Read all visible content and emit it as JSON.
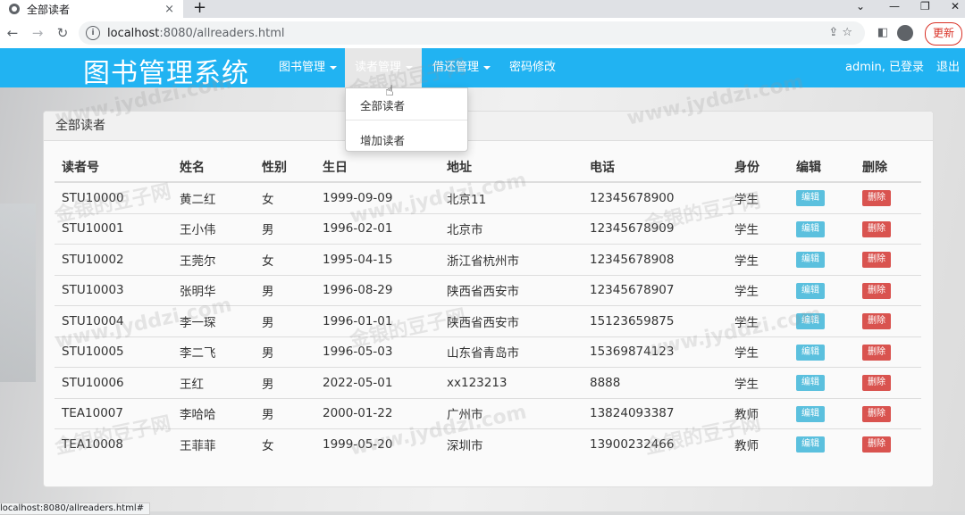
{
  "browser": {
    "tab_title": "全部读者",
    "tab_close": "×",
    "new_tab": "+",
    "url_host": "localhost",
    "url_path": ":8080/allreaders.html",
    "update_label": "更新",
    "status_url": "localhost:8080/allreaders.html#"
  },
  "nav": {
    "brand": "图书管理系统",
    "menus": [
      {
        "label": "图书管理"
      },
      {
        "label": "读者管理"
      },
      {
        "label": "借还管理"
      },
      {
        "label": "密码修改"
      }
    ],
    "user": "admin, 已登录",
    "logout": "退出"
  },
  "dropdown": {
    "items": [
      {
        "label": "全部读者"
      },
      {
        "label": "增加读者"
      }
    ]
  },
  "panel": {
    "title": "全部读者",
    "columns": [
      "读者号",
      "姓名",
      "性别",
      "生日",
      "地址",
      "电话",
      "身份",
      "编辑",
      "删除"
    ],
    "edit_label": "编辑",
    "delete_label": "删除",
    "rows": [
      {
        "id": "STU10000",
        "name": "黄二红",
        "sex": "女",
        "birth": "1999-09-09",
        "addr": "北京11",
        "phone": "12345678900",
        "role": "学生"
      },
      {
        "id": "STU10001",
        "name": "王小伟",
        "sex": "男",
        "birth": "1996-02-01",
        "addr": "北京市",
        "phone": "12345678909",
        "role": "学生"
      },
      {
        "id": "STU10002",
        "name": "王莞尔",
        "sex": "女",
        "birth": "1995-04-15",
        "addr": "浙江省杭州市",
        "phone": "12345678908",
        "role": "学生"
      },
      {
        "id": "STU10003",
        "name": "张明华",
        "sex": "男",
        "birth": "1996-08-29",
        "addr": "陕西省西安市",
        "phone": "12345678907",
        "role": "学生"
      },
      {
        "id": "STU10004",
        "name": "李一琛",
        "sex": "男",
        "birth": "1996-01-01",
        "addr": "陕西省西安市",
        "phone": "15123659875",
        "role": "学生"
      },
      {
        "id": "STU10005",
        "name": "李二飞",
        "sex": "男",
        "birth": "1996-05-03",
        "addr": "山东省青岛市",
        "phone": "15369874123",
        "role": "学生"
      },
      {
        "id": "STU10006",
        "name": "王红",
        "sex": "男",
        "birth": "2022-05-01",
        "addr": "xx123213",
        "phone": "8888",
        "role": "学生"
      },
      {
        "id": "TEA10007",
        "name": "李哈哈",
        "sex": "男",
        "birth": "2000-01-22",
        "addr": "广州市",
        "phone": "13824093387",
        "role": "教师"
      },
      {
        "id": "TEA10008",
        "name": "王菲菲",
        "sex": "女",
        "birth": "1999-05-20",
        "addr": "深圳市",
        "phone": "13900232466",
        "role": "教师"
      }
    ]
  },
  "watermark": {
    "text1": "金银的豆子网",
    "text2": "www.jyddzi.com"
  }
}
